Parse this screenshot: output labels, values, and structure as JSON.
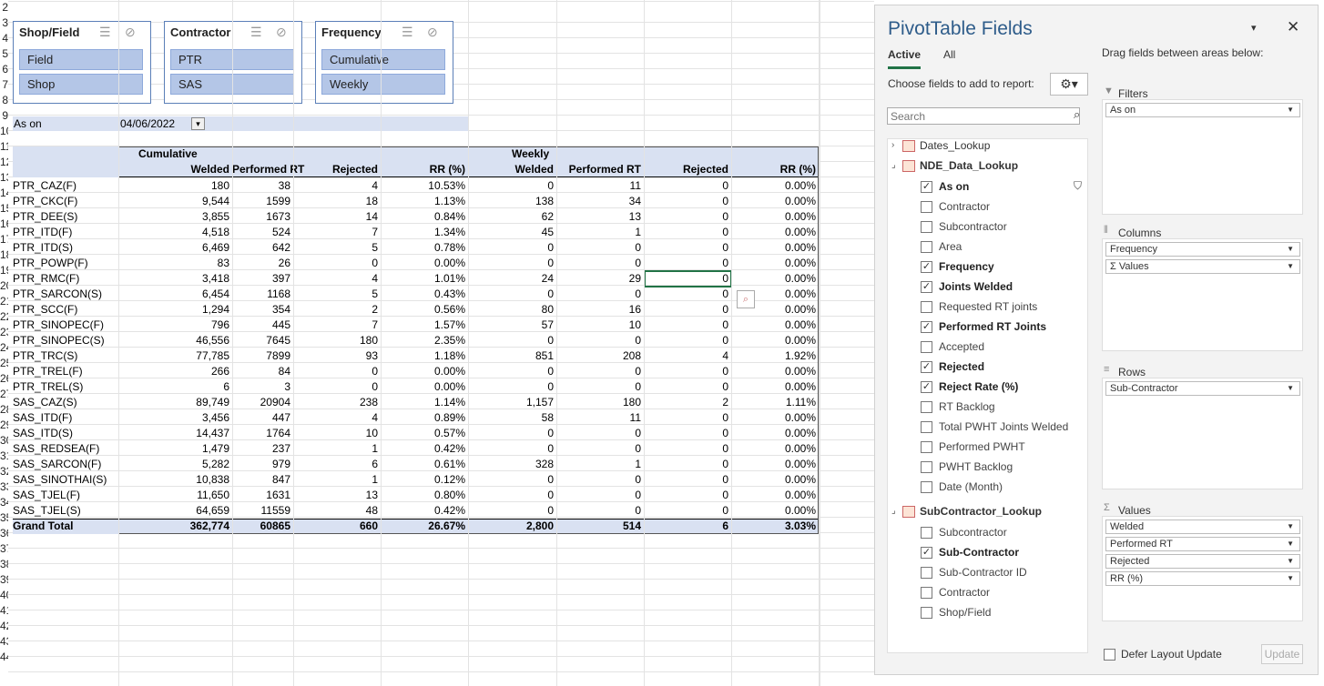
{
  "row_numbers": [
    "2",
    "3",
    "4",
    "5",
    "6",
    "7",
    "8",
    "9",
    "10",
    "11",
    "12",
    "13",
    "14",
    "15",
    "16",
    "17",
    "18",
    "19",
    "20",
    "21",
    "22",
    "23",
    "24",
    "25",
    "26",
    "27",
    "28",
    "29",
    "30",
    "31",
    "32",
    "33",
    "34",
    "35",
    "36",
    "37",
    "38",
    "39",
    "40",
    "41",
    "42",
    "43",
    "44"
  ],
  "slicers": [
    {
      "title": "Shop/Field",
      "items": [
        "Field",
        "Shop"
      ]
    },
    {
      "title": "Contractor",
      "items": [
        "PTR",
        "SAS"
      ]
    },
    {
      "title": "Frequency",
      "items": [
        "Cumulative",
        "Weekly"
      ]
    }
  ],
  "filter": {
    "label": "As on",
    "value": "04/06/2022"
  },
  "pivot": {
    "groups": [
      "Cumulative",
      "Weekly"
    ],
    "headers": [
      "Welded",
      "Performed RT",
      "Rejected",
      "RR (%)",
      "Welded",
      "Performed RT",
      "Rejected",
      "RR (%)"
    ],
    "rows": [
      [
        "PTR_CAZ(F)",
        "180",
        "38",
        "4",
        "10.53%",
        "0",
        "11",
        "0",
        "0.00%"
      ],
      [
        "PTR_CKC(F)",
        "9,544",
        "1599",
        "18",
        "1.13%",
        "138",
        "34",
        "0",
        "0.00%"
      ],
      [
        "PTR_DEE(S)",
        "3,855",
        "1673",
        "14",
        "0.84%",
        "62",
        "13",
        "0",
        "0.00%"
      ],
      [
        "PTR_ITD(F)",
        "4,518",
        "524",
        "7",
        "1.34%",
        "45",
        "1",
        "0",
        "0.00%"
      ],
      [
        "PTR_ITD(S)",
        "6,469",
        "642",
        "5",
        "0.78%",
        "0",
        "0",
        "0",
        "0.00%"
      ],
      [
        "PTR_POWP(F)",
        "83",
        "26",
        "0",
        "0.00%",
        "0",
        "0",
        "0",
        "0.00%"
      ],
      [
        "PTR_RMC(F)",
        "3,418",
        "397",
        "4",
        "1.01%",
        "24",
        "29",
        "0",
        "0.00%"
      ],
      [
        "PTR_SARCON(S)",
        "6,454",
        "1168",
        "5",
        "0.43%",
        "0",
        "0",
        "0",
        "0.00%"
      ],
      [
        "PTR_SCC(F)",
        "1,294",
        "354",
        "2",
        "0.56%",
        "80",
        "16",
        "0",
        "0.00%"
      ],
      [
        "PTR_SINOPEC(F)",
        "796",
        "445",
        "7",
        "1.57%",
        "57",
        "10",
        "0",
        "0.00%"
      ],
      [
        "PTR_SINOPEC(S)",
        "46,556",
        "7645",
        "180",
        "2.35%",
        "0",
        "0",
        "0",
        "0.00%"
      ],
      [
        "PTR_TRC(S)",
        "77,785",
        "7899",
        "93",
        "1.18%",
        "851",
        "208",
        "4",
        "1.92%"
      ],
      [
        "PTR_TREL(F)",
        "266",
        "84",
        "0",
        "0.00%",
        "0",
        "0",
        "0",
        "0.00%"
      ],
      [
        "PTR_TREL(S)",
        "6",
        "3",
        "0",
        "0.00%",
        "0",
        "0",
        "0",
        "0.00%"
      ],
      [
        "SAS_CAZ(S)",
        "89,749",
        "20904",
        "238",
        "1.14%",
        "1,157",
        "180",
        "2",
        "1.11%"
      ],
      [
        "SAS_ITD(F)",
        "3,456",
        "447",
        "4",
        "0.89%",
        "58",
        "11",
        "0",
        "0.00%"
      ],
      [
        "SAS_ITD(S)",
        "14,437",
        "1764",
        "10",
        "0.57%",
        "0",
        "0",
        "0",
        "0.00%"
      ],
      [
        "SAS_REDSEA(F)",
        "1,479",
        "237",
        "1",
        "0.42%",
        "0",
        "0",
        "0",
        "0.00%"
      ],
      [
        "SAS_SARCON(F)",
        "5,282",
        "979",
        "6",
        "0.61%",
        "328",
        "1",
        "0",
        "0.00%"
      ],
      [
        "SAS_SINOTHAI(S)",
        "10,838",
        "847",
        "1",
        "0.12%",
        "0",
        "0",
        "0",
        "0.00%"
      ],
      [
        "SAS_TJEL(F)",
        "11,650",
        "1631",
        "13",
        "0.80%",
        "0",
        "0",
        "0",
        "0.00%"
      ],
      [
        "SAS_TJEL(S)",
        "64,659",
        "11559",
        "48",
        "0.42%",
        "0",
        "0",
        "0",
        "0.00%"
      ]
    ],
    "grand_total": [
      "Grand Total",
      "362,774",
      "60865",
      "660",
      "26.67%",
      "2,800",
      "514",
      "6",
      "3.03%"
    ]
  },
  "panel": {
    "title": "PivotTable Fields",
    "tabs": [
      "Active",
      "All"
    ],
    "choose_label": "Choose fields to add to report:",
    "search_placeholder": "Search",
    "drag_label": "Drag fields between areas below:",
    "tables": [
      {
        "name": "Dates_Lookup",
        "fields": []
      },
      {
        "name": "NDE_Data_Lookup",
        "fields": [
          {
            "label": "As on",
            "checked": true
          },
          {
            "label": "Contractor",
            "checked": false
          },
          {
            "label": "Subcontractor",
            "checked": false
          },
          {
            "label": "Area",
            "checked": false
          },
          {
            "label": "Frequency",
            "checked": true
          },
          {
            "label": "Joints  Welded",
            "checked": true
          },
          {
            "label": "Requested RT joints",
            "checked": false
          },
          {
            "label": "Performed RT Joints",
            "checked": true
          },
          {
            "label": "Accepted",
            "checked": false
          },
          {
            "label": "Rejected",
            "checked": true
          },
          {
            "label": "Reject Rate (%)",
            "checked": true
          },
          {
            "label": "RT Backlog",
            "checked": false
          },
          {
            "label": "Total PWHT Joints Welded",
            "checked": false
          },
          {
            "label": "Performed PWHT",
            "checked": false
          },
          {
            "label": "PWHT Backlog",
            "checked": false
          },
          {
            "label": "Date (Month)",
            "checked": false
          }
        ]
      },
      {
        "name": "SubContractor_Lookup",
        "fields": [
          {
            "label": "Subcontractor",
            "checked": false
          },
          {
            "label": "Sub-Contractor",
            "checked": true
          },
          {
            "label": "Sub-Contractor ID",
            "checked": false
          },
          {
            "label": "Contractor",
            "checked": false
          },
          {
            "label": "Shop/Field",
            "checked": false
          }
        ]
      }
    ],
    "areas": {
      "filters": {
        "title": "Filters",
        "items": [
          "As on"
        ]
      },
      "columns": {
        "title": "Columns",
        "items": [
          "Frequency",
          "Σ Values"
        ]
      },
      "rows": {
        "title": "Rows",
        "items": [
          "Sub-Contractor"
        ]
      },
      "values": {
        "title": "Values",
        "items": [
          "Welded",
          "Performed RT",
          "Rejected",
          "RR (%)"
        ]
      }
    },
    "defer_label": "Defer Layout Update",
    "update_label": "Update"
  }
}
